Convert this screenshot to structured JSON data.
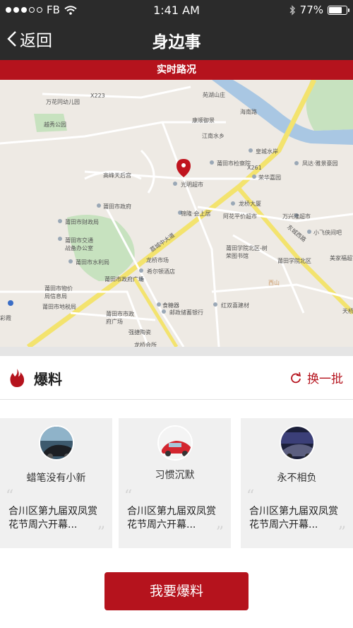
{
  "status_bar": {
    "carrier": "FB",
    "time": "1:41 AM",
    "battery": "77%",
    "battery_level": 0.77,
    "signal_dots": [
      true,
      true,
      true,
      false,
      false
    ]
  },
  "nav": {
    "back_label": "返回",
    "title": "身边事"
  },
  "realtime_label": "实时路况",
  "map": {
    "labels": [
      "万花同幼儿园",
      "X223",
      "苑湖山庄",
      "海南路",
      "越秀公园",
      "康顺御景",
      "江南水乡",
      "皇城水岸",
      "高峰天后宫",
      "莆田市检察院",
      "荣华嘉园",
      "凤达·雅景豪园",
      "光明超市",
      "莆田市政府",
      "X261",
      "龙桥大厦",
      "万兴隆超市",
      "莆田市财政局",
      "锦隆·会上居",
      "阿花平价超市",
      "东城西路",
      "小飞侠间吧",
      "莆田市交通战备办公室",
      "莆田市水利局",
      "荔城中大道",
      "龙桥市场",
      "莆田学院北区-树荣图书馆",
      "莆田学院北区",
      "美家福超市",
      "莆田市政府广场",
      "希尔顿酒店",
      "莆田市物价局信息局",
      "红双喜建材",
      "莆田市地税局",
      "莆田市市政府广场",
      "邮政储蓄银行",
      "食糖器",
      "强捷陶瓷",
      "西山",
      "天桥",
      "彩霞",
      "龙桥会所"
    ]
  },
  "section": {
    "title": "爆料",
    "refresh_label": "换一批",
    "accent": "#b5131d"
  },
  "cards": [
    {
      "user": "蜡笔没有小新",
      "text": "合川区第九届双凤赏花节周六开幕..."
    },
    {
      "user": "习惯沉默",
      "text": "合川区第九届双凤赏花节周六开幕..."
    },
    {
      "user": "永不相负",
      "text": "合川区第九届双凤赏花节周六开幕..."
    }
  ],
  "cta_label": "我要爆料"
}
